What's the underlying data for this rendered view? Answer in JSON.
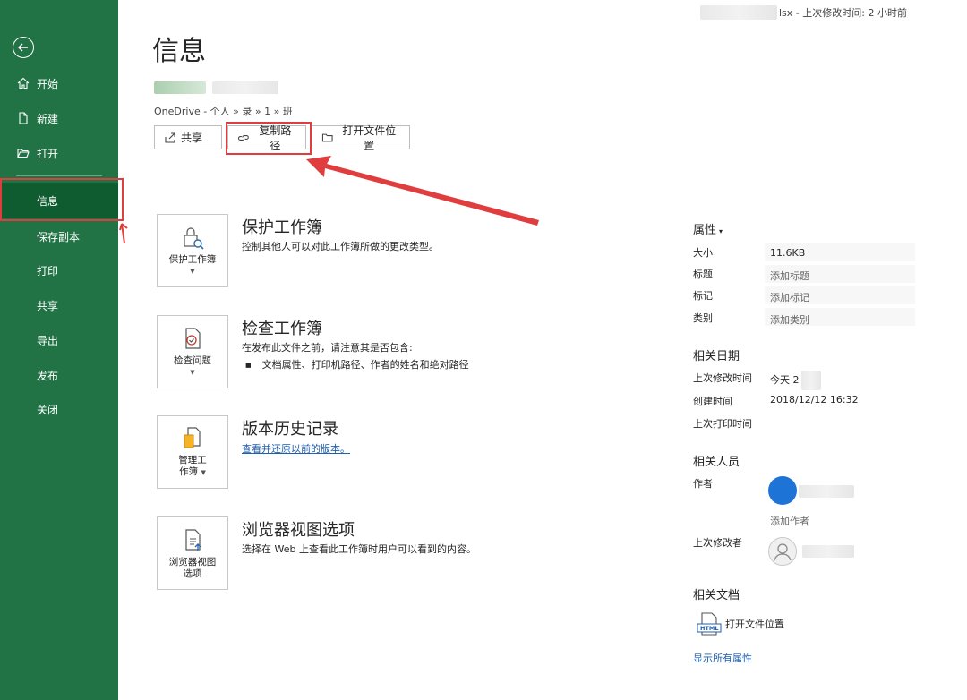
{
  "sidebar": {
    "back_label": "",
    "items": [
      {
        "label": "开始"
      },
      {
        "label": "新建"
      },
      {
        "label": "打开"
      },
      {
        "label": "信息"
      },
      {
        "label": "保存副本"
      },
      {
        "label": "打印"
      },
      {
        "label": "共享"
      },
      {
        "label": "导出"
      },
      {
        "label": "发布"
      },
      {
        "label": "关闭"
      }
    ]
  },
  "header": {
    "doc_status_suffix": "lsx - 上次修改时间: 2 小时前",
    "title": "信息",
    "path": "OneDrive - 个人 » 录 » 1 »  班"
  },
  "actions": {
    "share": "共享",
    "copy_path": "复制路径",
    "open_location": "打开文件位置"
  },
  "sections": [
    {
      "button": "保护工作簿",
      "title": "保护工作簿",
      "desc": "控制其他人可以对此工作簿所做的更改类型。"
    },
    {
      "button": "检查问题",
      "title": "检查工作簿",
      "desc": "在发布此文件之前，请注意其是否包含:",
      "bullet": "文档属性、打印机路径、作者的姓名和绝对路径"
    },
    {
      "button_line1": "管理工",
      "button_line2": "作簿",
      "title": "版本历史记录",
      "link": "查看并还原以前的版本。"
    },
    {
      "button_line1": "浏览器视图",
      "button_line2": "选项",
      "title": "浏览器视图选项",
      "desc": "选择在 Web 上查看此工作簿时用户可以看到的内容。"
    }
  ],
  "properties": {
    "heading": "属性",
    "rows": [
      {
        "label": "大小",
        "value": "11.6KB"
      },
      {
        "label": "标题",
        "value": "添加标题"
      },
      {
        "label": "标记",
        "value": "添加标记"
      },
      {
        "label": "类别",
        "value": "添加类别"
      }
    ],
    "dates_heading": "相关日期",
    "dates": [
      {
        "label": "上次修改时间",
        "value": "今天 2"
      },
      {
        "label": "创建时间",
        "value": "2018/12/12 16:32"
      },
      {
        "label": "上次打印时间",
        "value": ""
      }
    ],
    "people_heading": "相关人员",
    "author_label": "作者",
    "add_author": "添加作者",
    "last_modified_by_label": "上次修改者",
    "docs_heading": "相关文档",
    "open_location": "打开文件位置",
    "html_badge": "HTML",
    "show_all": "显示所有属性"
  },
  "colors": {
    "sidebar": "#217346",
    "sidebar_active": "#0e5c30",
    "annotation": "#e03e3e",
    "link": "#1f5fad"
  }
}
